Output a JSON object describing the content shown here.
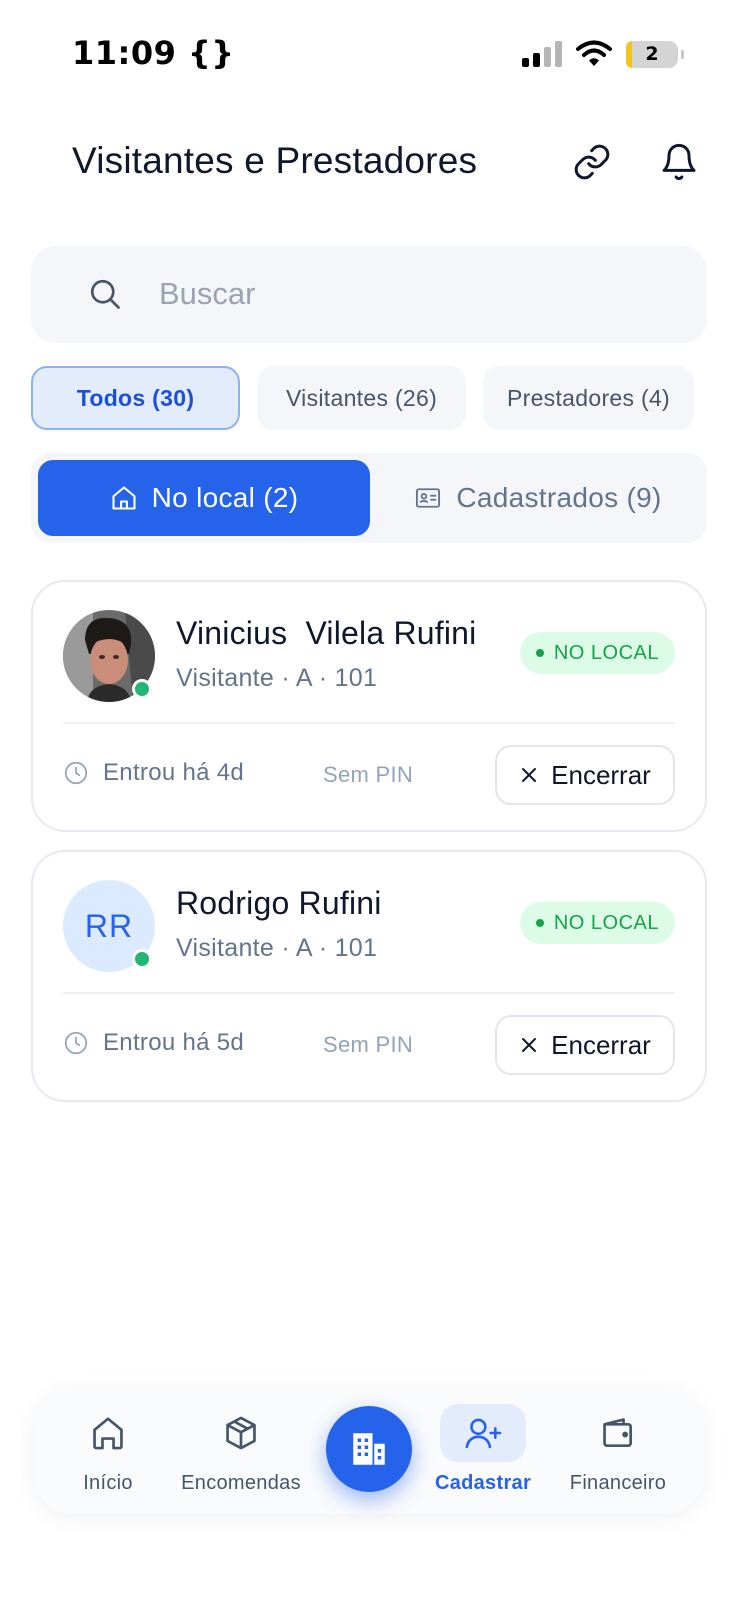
{
  "status_bar": {
    "time": "11:09 {}",
    "battery": "2"
  },
  "header": {
    "title": "Visitantes e Prestadores"
  },
  "search": {
    "placeholder": "Buscar"
  },
  "filters": [
    {
      "label": "Todos (30)",
      "active": true
    },
    {
      "label": "Visitantes (26)",
      "active": false
    },
    {
      "label": "Prestadores (4)",
      "active": false
    }
  ],
  "segments": [
    {
      "label": "No local (2)",
      "active": true,
      "icon": "home-icon"
    },
    {
      "label": "Cadastrados (9)",
      "active": false,
      "icon": "id-card-icon"
    }
  ],
  "cards": [
    {
      "name": "Vinicius  Vilela Rufini",
      "subtitle": "Visitante · A · 101",
      "status": "NO LOCAL",
      "entered": "Entrou há 4d",
      "pin": "Sem PIN",
      "action": "Encerrar",
      "avatar": "photo"
    },
    {
      "name": "Rodrigo Rufini",
      "subtitle": "Visitante · A · 101",
      "status": "NO LOCAL",
      "entered": "Entrou há 5d",
      "pin": "Sem PIN",
      "action": "Encerrar",
      "initials": "RR"
    }
  ],
  "bottom_nav": [
    {
      "label": "Início",
      "icon": "home-icon"
    },
    {
      "label": "Encomendas",
      "icon": "package-icon"
    },
    {
      "label": "",
      "icon": "building-icon"
    },
    {
      "label": "Cadastrar",
      "icon": "user-plus-icon",
      "active": true
    },
    {
      "label": "Financeiro",
      "icon": "wallet-icon"
    }
  ],
  "colors": {
    "accent": "#2563eb",
    "status_green": "#16a34a",
    "status_green_bg": "#dcfce7"
  }
}
